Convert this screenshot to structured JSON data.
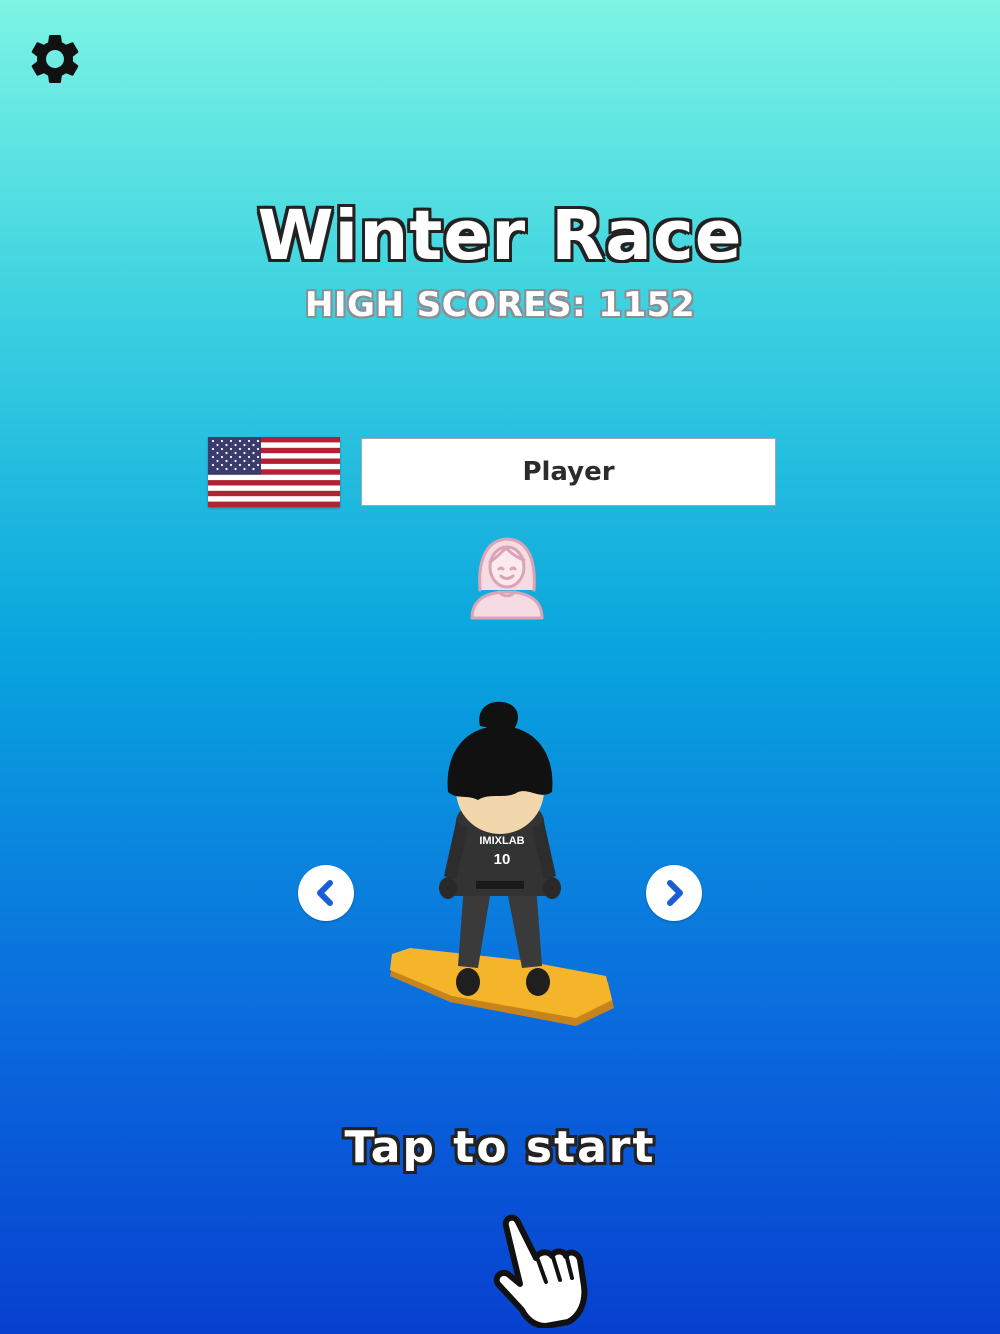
{
  "settings": {
    "icon": "gear-icon",
    "color": "#111111"
  },
  "title": "Winter Race",
  "high_scores": "HIGH SCORES: 1152",
  "profile": {
    "flag": "us-flag",
    "player_name": "Player",
    "avatar_icon": "female-avatar-icon",
    "avatar_color": "#d9a5b6"
  },
  "character": {
    "jersey_brand": "IMIXLAB",
    "jersey_number": "10",
    "board_color": "#f5b52a"
  },
  "navigation": {
    "prev_icon": "chevron-left-icon",
    "next_icon": "chevron-right-icon",
    "arrow_color": "#1a5ed6"
  },
  "cta": "Tap to start",
  "hand_icon": "pointing-hand-icon"
}
